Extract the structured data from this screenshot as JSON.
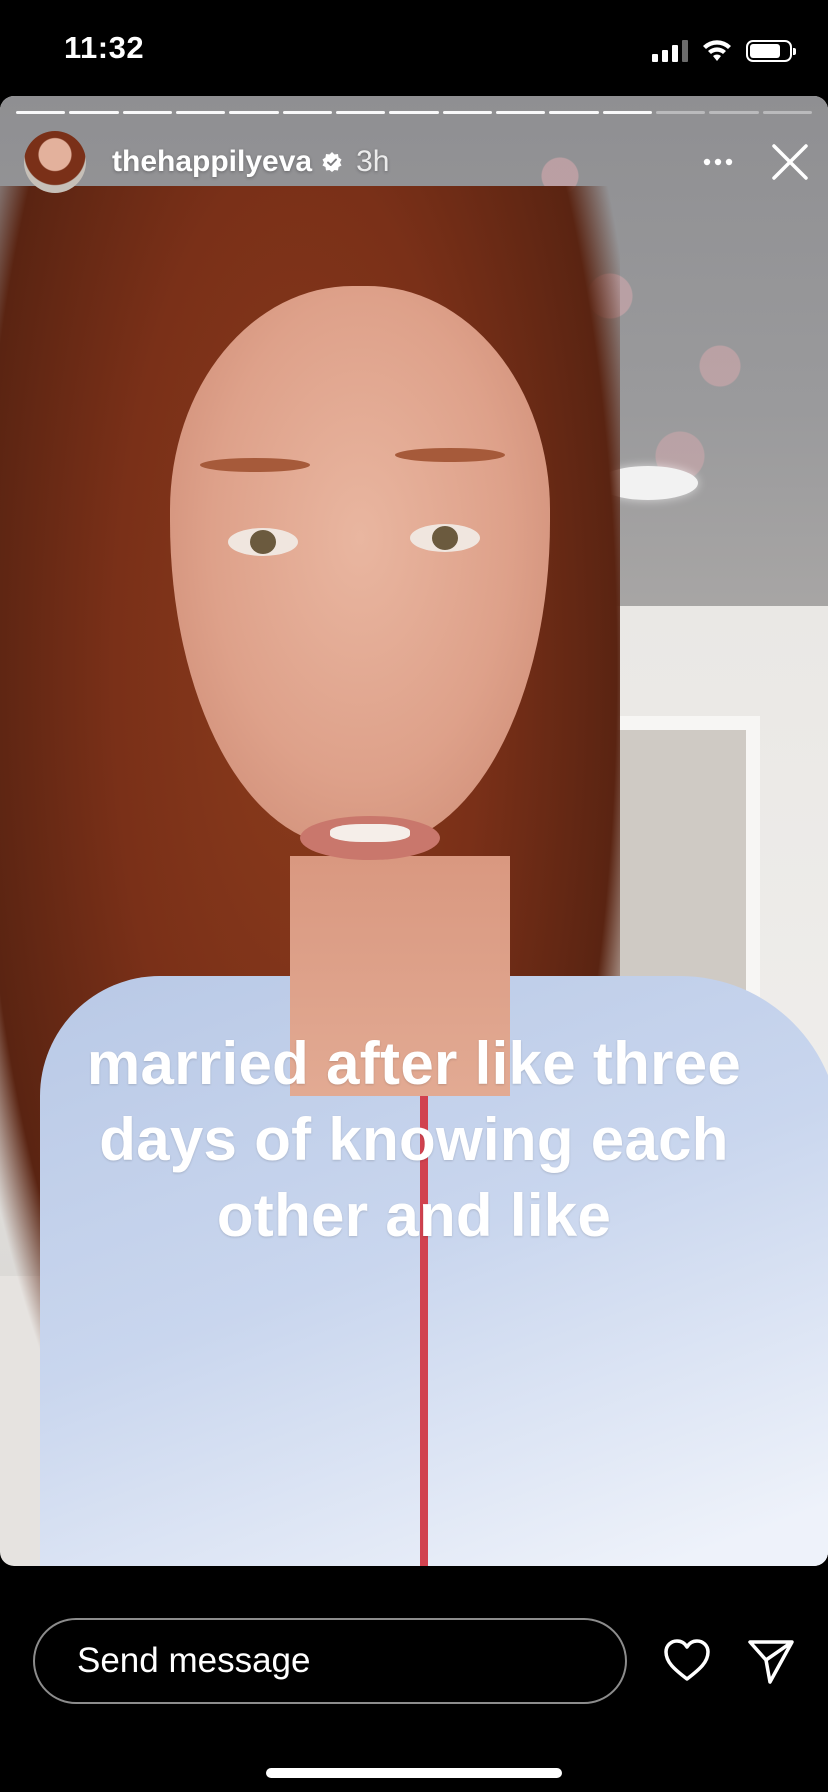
{
  "status_bar": {
    "time": "11:32",
    "battery_level": 0.8
  },
  "story": {
    "progress": {
      "total_segments": 15,
      "current_segment": 12
    },
    "username": "thehappilyeva",
    "verified": true,
    "time_ago": "3h",
    "caption_lines": [
      "married after like three",
      "days of knowing each",
      "other and like"
    ]
  },
  "reply_bar": {
    "placeholder": "Send message"
  },
  "icons": {
    "avatar": "profile-avatar",
    "verified": "verified-badge-icon",
    "more": "more-horizontal-icon",
    "close": "close-icon",
    "like": "heart-icon",
    "share": "send-paper-plane-icon"
  },
  "colors": {
    "background": "#000000",
    "text": "#ffffff",
    "verified_badge": "#ffffff"
  }
}
